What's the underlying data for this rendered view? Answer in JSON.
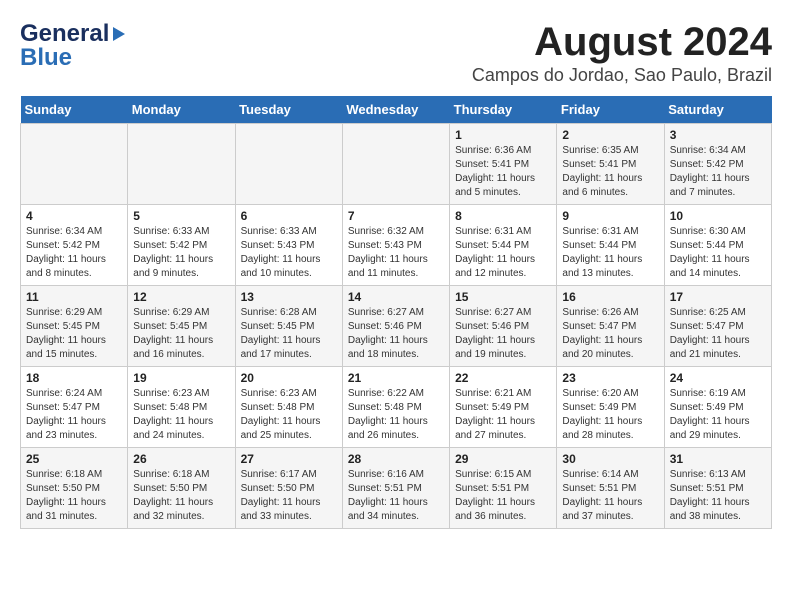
{
  "logo": {
    "part1": "General",
    "part2": "Blue"
  },
  "title": {
    "month_year": "August 2024",
    "location": "Campos do Jordao, Sao Paulo, Brazil"
  },
  "days_of_week": [
    "Sunday",
    "Monday",
    "Tuesday",
    "Wednesday",
    "Thursday",
    "Friday",
    "Saturday"
  ],
  "weeks": [
    [
      {
        "day": "",
        "info": ""
      },
      {
        "day": "",
        "info": ""
      },
      {
        "day": "",
        "info": ""
      },
      {
        "day": "",
        "info": ""
      },
      {
        "day": "1",
        "info": "Sunrise: 6:36 AM\nSunset: 5:41 PM\nDaylight: 11 hours and 5 minutes."
      },
      {
        "day": "2",
        "info": "Sunrise: 6:35 AM\nSunset: 5:41 PM\nDaylight: 11 hours and 6 minutes."
      },
      {
        "day": "3",
        "info": "Sunrise: 6:34 AM\nSunset: 5:42 PM\nDaylight: 11 hours and 7 minutes."
      }
    ],
    [
      {
        "day": "4",
        "info": "Sunrise: 6:34 AM\nSunset: 5:42 PM\nDaylight: 11 hours and 8 minutes."
      },
      {
        "day": "5",
        "info": "Sunrise: 6:33 AM\nSunset: 5:42 PM\nDaylight: 11 hours and 9 minutes."
      },
      {
        "day": "6",
        "info": "Sunrise: 6:33 AM\nSunset: 5:43 PM\nDaylight: 11 hours and 10 minutes."
      },
      {
        "day": "7",
        "info": "Sunrise: 6:32 AM\nSunset: 5:43 PM\nDaylight: 11 hours and 11 minutes."
      },
      {
        "day": "8",
        "info": "Sunrise: 6:31 AM\nSunset: 5:44 PM\nDaylight: 11 hours and 12 minutes."
      },
      {
        "day": "9",
        "info": "Sunrise: 6:31 AM\nSunset: 5:44 PM\nDaylight: 11 hours and 13 minutes."
      },
      {
        "day": "10",
        "info": "Sunrise: 6:30 AM\nSunset: 5:44 PM\nDaylight: 11 hours and 14 minutes."
      }
    ],
    [
      {
        "day": "11",
        "info": "Sunrise: 6:29 AM\nSunset: 5:45 PM\nDaylight: 11 hours and 15 minutes."
      },
      {
        "day": "12",
        "info": "Sunrise: 6:29 AM\nSunset: 5:45 PM\nDaylight: 11 hours and 16 minutes."
      },
      {
        "day": "13",
        "info": "Sunrise: 6:28 AM\nSunset: 5:45 PM\nDaylight: 11 hours and 17 minutes."
      },
      {
        "day": "14",
        "info": "Sunrise: 6:27 AM\nSunset: 5:46 PM\nDaylight: 11 hours and 18 minutes."
      },
      {
        "day": "15",
        "info": "Sunrise: 6:27 AM\nSunset: 5:46 PM\nDaylight: 11 hours and 19 minutes."
      },
      {
        "day": "16",
        "info": "Sunrise: 6:26 AM\nSunset: 5:47 PM\nDaylight: 11 hours and 20 minutes."
      },
      {
        "day": "17",
        "info": "Sunrise: 6:25 AM\nSunset: 5:47 PM\nDaylight: 11 hours and 21 minutes."
      }
    ],
    [
      {
        "day": "18",
        "info": "Sunrise: 6:24 AM\nSunset: 5:47 PM\nDaylight: 11 hours and 23 minutes."
      },
      {
        "day": "19",
        "info": "Sunrise: 6:23 AM\nSunset: 5:48 PM\nDaylight: 11 hours and 24 minutes."
      },
      {
        "day": "20",
        "info": "Sunrise: 6:23 AM\nSunset: 5:48 PM\nDaylight: 11 hours and 25 minutes."
      },
      {
        "day": "21",
        "info": "Sunrise: 6:22 AM\nSunset: 5:48 PM\nDaylight: 11 hours and 26 minutes."
      },
      {
        "day": "22",
        "info": "Sunrise: 6:21 AM\nSunset: 5:49 PM\nDaylight: 11 hours and 27 minutes."
      },
      {
        "day": "23",
        "info": "Sunrise: 6:20 AM\nSunset: 5:49 PM\nDaylight: 11 hours and 28 minutes."
      },
      {
        "day": "24",
        "info": "Sunrise: 6:19 AM\nSunset: 5:49 PM\nDaylight: 11 hours and 29 minutes."
      }
    ],
    [
      {
        "day": "25",
        "info": "Sunrise: 6:18 AM\nSunset: 5:50 PM\nDaylight: 11 hours and 31 minutes."
      },
      {
        "day": "26",
        "info": "Sunrise: 6:18 AM\nSunset: 5:50 PM\nDaylight: 11 hours and 32 minutes."
      },
      {
        "day": "27",
        "info": "Sunrise: 6:17 AM\nSunset: 5:50 PM\nDaylight: 11 hours and 33 minutes."
      },
      {
        "day": "28",
        "info": "Sunrise: 6:16 AM\nSunset: 5:51 PM\nDaylight: 11 hours and 34 minutes."
      },
      {
        "day": "29",
        "info": "Sunrise: 6:15 AM\nSunset: 5:51 PM\nDaylight: 11 hours and 36 minutes."
      },
      {
        "day": "30",
        "info": "Sunrise: 6:14 AM\nSunset: 5:51 PM\nDaylight: 11 hours and 37 minutes."
      },
      {
        "day": "31",
        "info": "Sunrise: 6:13 AM\nSunset: 5:51 PM\nDaylight: 11 hours and 38 minutes."
      }
    ]
  ]
}
